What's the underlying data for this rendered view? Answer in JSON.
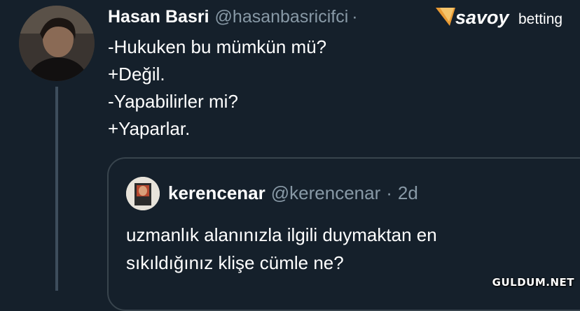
{
  "tweet": {
    "author_name": "Hasan Basri",
    "author_handle": "@hasanbasricifci",
    "separator": "·",
    "lines": [
      "-Hukuken bu mümkün mü?",
      "+Değil.",
      "-Yapabilirler mi?",
      "+Yaparlar."
    ]
  },
  "quoted_tweet": {
    "author_name": "kerencenar",
    "author_handle": "@kerencenar",
    "separator": "·",
    "time": "2d",
    "lines": [
      "uzmanlık alanınızla ilgili duymaktan en",
      "sıkıldığınız klişe cümle ne?"
    ]
  },
  "watermark": {
    "brand_main": "savoy",
    "brand_suffix": "betting"
  },
  "site_tag": "GULDUM.NET",
  "colors": {
    "background": "#15202b",
    "secondary_text": "#8899a6",
    "border": "#38444d",
    "brand_orange": "#f2a03a"
  }
}
